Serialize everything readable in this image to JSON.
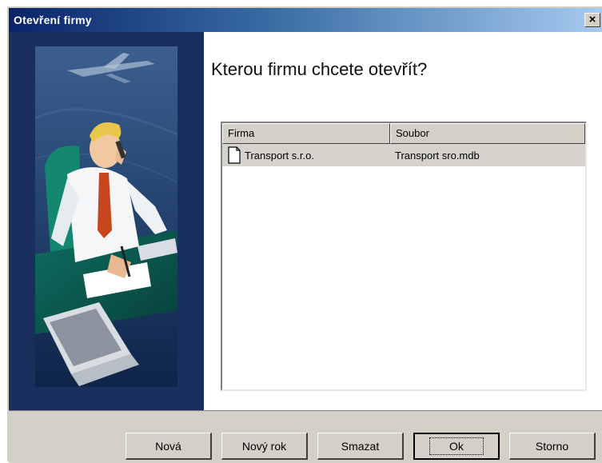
{
  "window": {
    "title": "Otevření firmy",
    "close_label": "×"
  },
  "main": {
    "heading": "Kterou firmu chcete otevřít?"
  },
  "list": {
    "columns": [
      "Firma",
      "Soubor"
    ],
    "rows": [
      {
        "firma": "Transport s.r.o.",
        "soubor": "Transport sro.mdb",
        "icon": "document-icon",
        "selected": true
      }
    ]
  },
  "buttons": {
    "nova": "Nová",
    "novy_rok": "Nový rok",
    "smazat": "Smazat",
    "ok": "Ok",
    "storno": "Storno"
  },
  "colors": {
    "title_gradient_start": "#0a246a",
    "title_gradient_end": "#a6caf0",
    "panel_background": "#1a2f5e",
    "dialog_face": "#d4d0c8"
  }
}
